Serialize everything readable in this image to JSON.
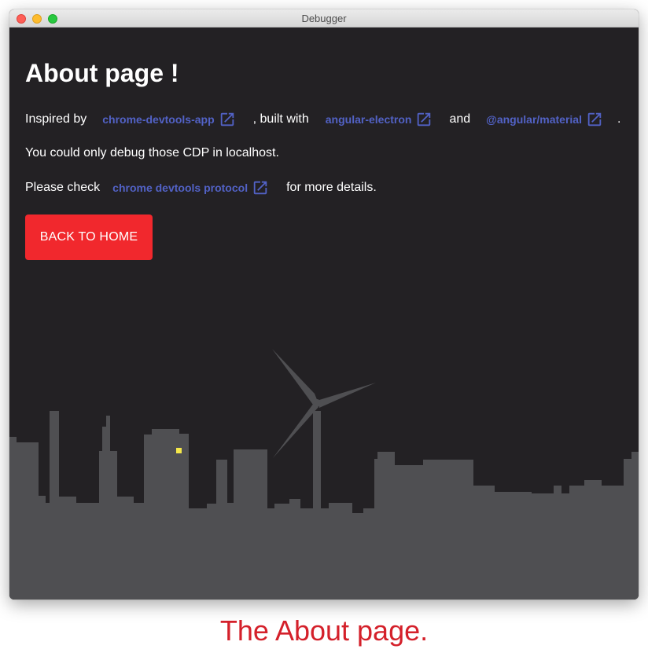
{
  "window": {
    "title": "Debugger"
  },
  "page": {
    "title": "About page !",
    "line1": {
      "prefix": "Inspired by",
      "link1": "chrome-devtools-app",
      "middle": ", built with",
      "link2": "angular-electron",
      "and": "and",
      "link3": "@angular/material",
      "end": "."
    },
    "line2": "You could only debug those CDP in localhost.",
    "line3": {
      "prefix": "Please check",
      "link": "chrome devtools protocol",
      "suffix": "for more details."
    },
    "back_button": "BACK TO HOME"
  },
  "caption": "The About page.",
  "colors": {
    "background": "#232124",
    "link": "#5262c6",
    "button": "#f1282d",
    "skyline": "#4f4f52",
    "window_light": "#f5e84a",
    "caption": "#d4202a"
  },
  "icons": {
    "external_link": "open-in-new-icon",
    "illustration": "city-skyline-wind-turbine"
  }
}
